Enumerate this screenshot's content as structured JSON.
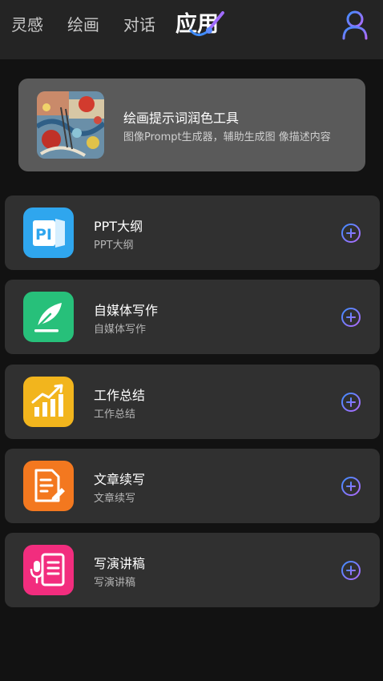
{
  "header": {
    "tabs": [
      {
        "label": "灵感"
      },
      {
        "label": "绘画"
      },
      {
        "label": "对话"
      },
      {
        "label": "应用"
      }
    ],
    "active_tab": "应用",
    "user_icon": "user-icon",
    "background_color": "#242424"
  },
  "featured": {
    "title": "绘画提示词润色工具",
    "description": "图像Prompt生成器，辅助生成图 像描述内容",
    "thumbnail_icon": "abstract-painting-thumbnail"
  },
  "apps": [
    {
      "title": "PPT大纲",
      "subtitle": "PPT大纲",
      "icon": "ppt-icon",
      "color": "#2fa6ee"
    },
    {
      "title": "自媒体写作",
      "subtitle": "自媒体写作",
      "icon": "feather-pen-icon",
      "color": "#27c07a"
    },
    {
      "title": "工作总结",
      "subtitle": "工作总结",
      "icon": "growth-chart-icon",
      "color": "#f2b51d"
    },
    {
      "title": "文章续写",
      "subtitle": "文章续写",
      "icon": "document-edit-icon",
      "color": "#f3781f"
    },
    {
      "title": "写演讲稿",
      "subtitle": "写演讲稿",
      "icon": "microphone-script-icon",
      "color": "#f22d7e"
    }
  ],
  "colors": {
    "page_background": "#121212",
    "card_background": "#303030",
    "featured_background": "#5a5a5a",
    "accent_gradient_start": "#3f8cff",
    "accent_gradient_end": "#b36bff"
  }
}
